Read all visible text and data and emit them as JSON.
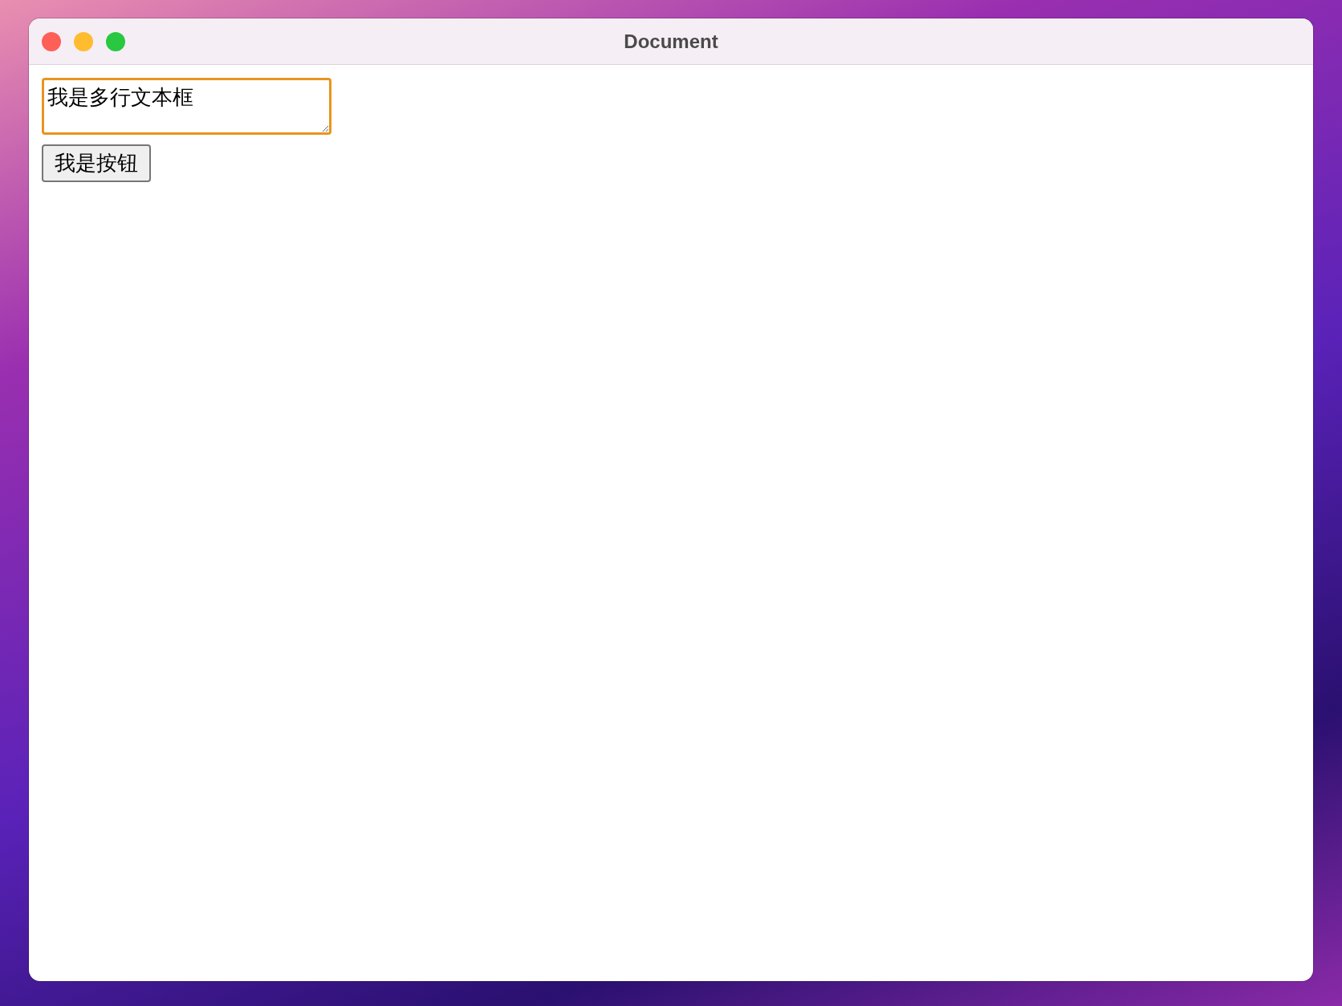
{
  "window": {
    "title": "Document"
  },
  "textarea": {
    "value": "我是多行文本框",
    "focused": true
  },
  "button": {
    "label": "我是按钮"
  }
}
